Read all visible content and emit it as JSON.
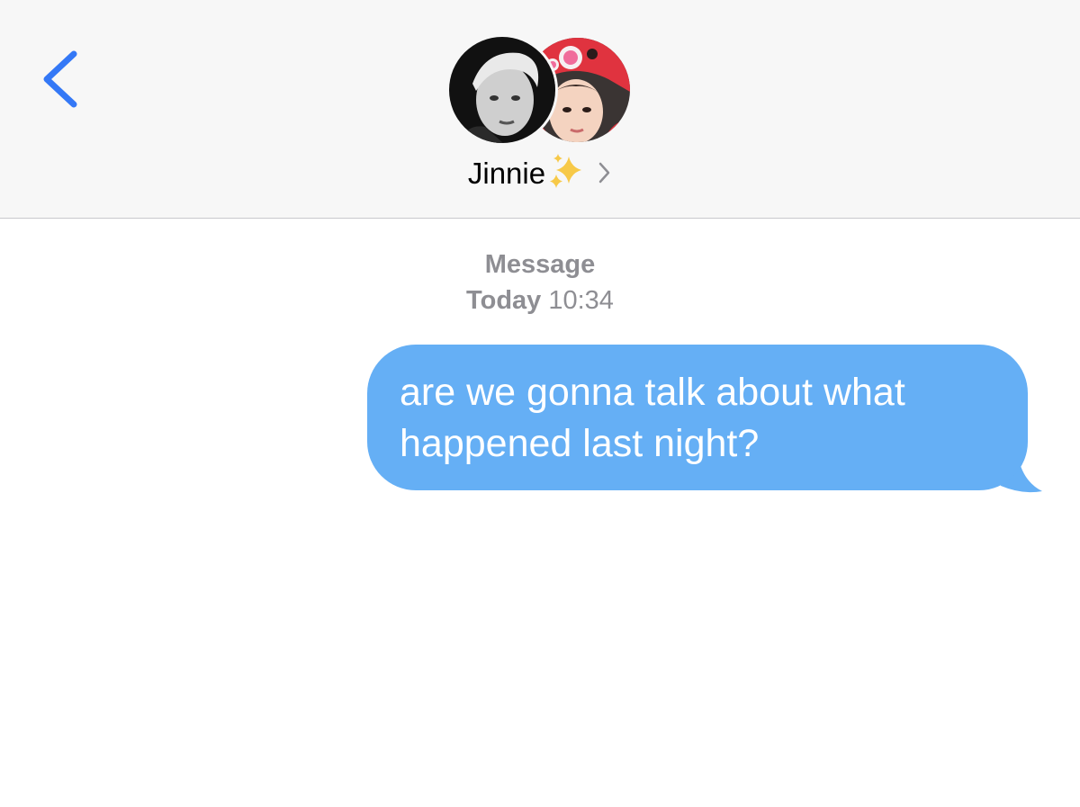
{
  "header": {
    "contact_name": "Jinnie",
    "back_icon": "chevron-left-icon",
    "name_emoji": "sparkles-icon",
    "details_icon": "chevron-right-icon",
    "accent_color": "#3478f6"
  },
  "conversation": {
    "service_label": "Message",
    "timestamp_day": "Today",
    "timestamp_time": "10:34",
    "messages": [
      {
        "direction": "outgoing",
        "text": "are we gonna talk about what happened last night?"
      }
    ],
    "outgoing_bubble_color": "#65aff5"
  }
}
